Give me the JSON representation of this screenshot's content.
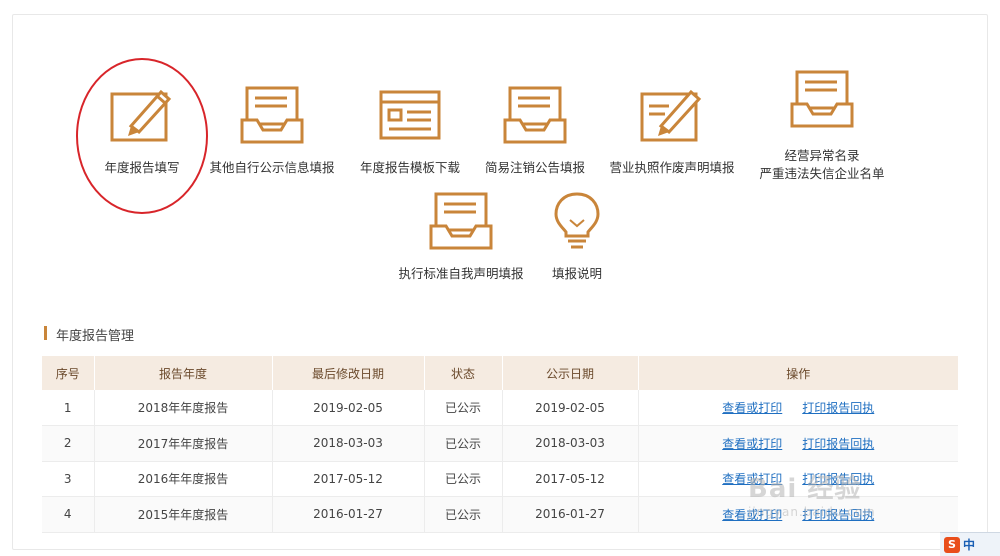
{
  "tiles": [
    {
      "label": "年度报告填写",
      "icon": "pencil-edit-icon"
    },
    {
      "label": "其他自行公示信息填报",
      "icon": "inbox-tray-icon"
    },
    {
      "label": "年度报告模板下载",
      "icon": "document-form-icon"
    },
    {
      "label": "简易注销公告填报",
      "icon": "inbox-tray-icon"
    },
    {
      "label": "营业执照作废声明填报",
      "icon": "pencil-edit-icon"
    },
    {
      "label": "经营异常名录",
      "label2": "严重违法失信企业名单",
      "icon": "inbox-tray-icon"
    },
    {
      "label": "执行标准自我声明填报",
      "icon": "inbox-tray-icon"
    },
    {
      "label": "填报说明",
      "icon": "lightbulb-icon"
    }
  ],
  "section": {
    "title": "年度报告管理"
  },
  "table": {
    "headers": [
      "序号",
      "报告年度",
      "最后修改日期",
      "状态",
      "公示日期",
      "操作"
    ],
    "rows": [
      {
        "no": "1",
        "year": "2018年年度报告",
        "modified": "2019-02-05",
        "status": "已公示",
        "published": "2019-02-05",
        "op1": "查看或打印",
        "op2": "打印报告回执"
      },
      {
        "no": "2",
        "year": "2017年年度报告",
        "modified": "2018-03-03",
        "status": "已公示",
        "published": "2018-03-03",
        "op1": "查看或打印",
        "op2": "打印报告回执"
      },
      {
        "no": "3",
        "year": "2016年年度报告",
        "modified": "2017-05-12",
        "status": "已公示",
        "published": "2017-05-12",
        "op1": "查看或打印",
        "op2": "打印报告回执"
      },
      {
        "no": "4",
        "year": "2015年年度报告",
        "modified": "2016-01-27",
        "status": "已公示",
        "published": "2016-01-27",
        "op1": "查看或打印",
        "op2": "打印报告回执"
      }
    ]
  },
  "watermark": {
    "text": "Bai 经验",
    "sub": "jingyan.baidu.com"
  },
  "ime": {
    "logo": "S",
    "mode": "中"
  },
  "colors": {
    "accent": "#c9853a",
    "link": "#1f6fc1",
    "highlight": "#d8252a"
  }
}
